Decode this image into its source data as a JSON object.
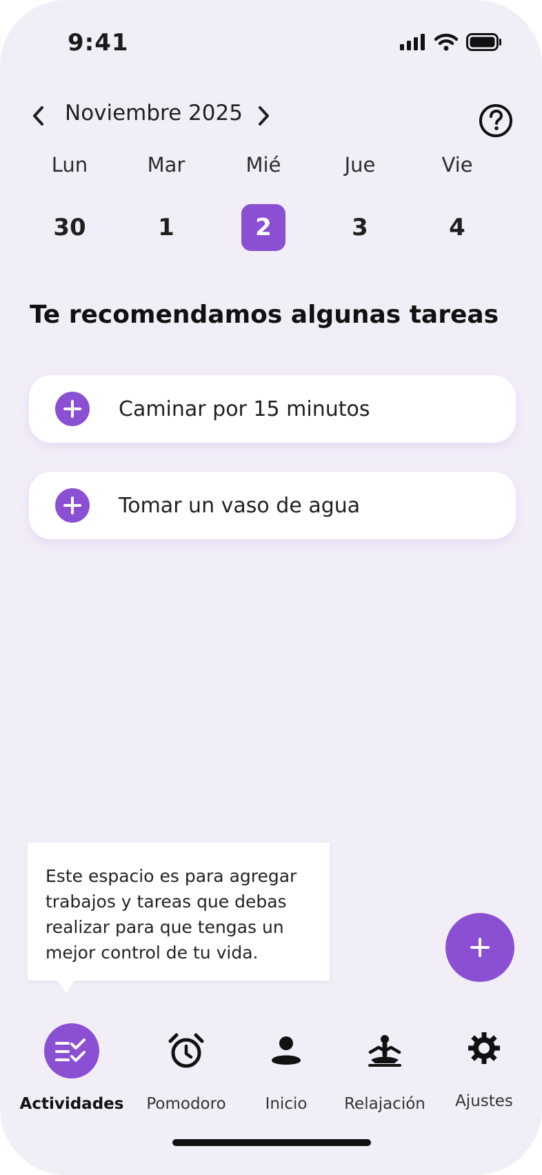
{
  "status_bar": {
    "time": "9:41"
  },
  "calendar": {
    "month_label": "Noviembre 2025",
    "days": [
      {
        "name": "Lun",
        "number": "30",
        "selected": false
      },
      {
        "name": "Mar",
        "number": "1",
        "selected": false
      },
      {
        "name": "Mié",
        "number": "2",
        "selected": true
      },
      {
        "name": "Jue",
        "number": "3",
        "selected": false
      },
      {
        "name": "Vie",
        "number": "4",
        "selected": false
      }
    ]
  },
  "recommendations": {
    "title": "Te recomendamos algunas tareas",
    "tasks": [
      {
        "label": "Caminar por 15 minutos",
        "icon": "plus-icon"
      },
      {
        "label": "Tomar un vaso de agua",
        "icon": "plus-icon"
      }
    ]
  },
  "tooltip": {
    "text": "Este espacio es para agregar trabajos y tareas que debas realizar para que tengas un mejor control de tu vida."
  },
  "bottom_nav": {
    "items": [
      {
        "label": "Actividades",
        "icon": "checklist-icon",
        "active": true
      },
      {
        "label": "Pomodoro",
        "icon": "alarm-clock-icon",
        "active": false
      },
      {
        "label": "Inicio",
        "icon": "person-icon",
        "active": false
      },
      {
        "label": "Relajación",
        "icon": "meditation-icon",
        "active": false
      },
      {
        "label": "Ajustes",
        "icon": "gear-icon",
        "active": false
      }
    ]
  },
  "colors": {
    "accent": "#8a4fd3",
    "background": "#f2eef8",
    "card": "#ffffff"
  }
}
